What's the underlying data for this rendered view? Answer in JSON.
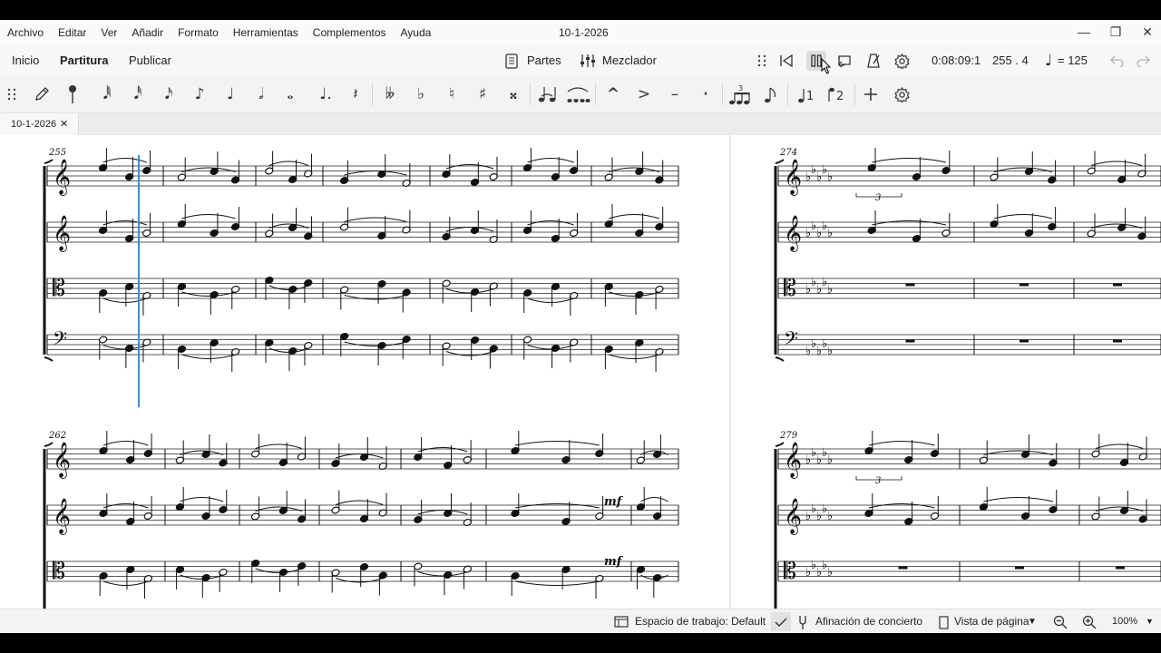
{
  "menu": [
    "Archivo",
    "Editar",
    "Ver",
    "Añadir",
    "Formato",
    "Herramientas",
    "Complementos",
    "Ayuda"
  ],
  "window": {
    "title": "10-1-2026",
    "minimize": "—",
    "restore": "❐",
    "close": "✕"
  },
  "tabs": {
    "home": "Inicio",
    "score": "Partitura",
    "publish": "Publicar"
  },
  "toolbar": {
    "parts_label": "Partes",
    "mixer_label": "Mezclador",
    "time": "0:08:09:1",
    "position": "255 . 4",
    "tempo_symbol": "♩",
    "tempo_value": "= 125"
  },
  "palette": {
    "dur_64": "𝅘𝅥𝅱",
    "dur_32": "𝅘𝅥𝅰",
    "dur_16": "𝅘𝅥𝅯",
    "dur_8": "♪",
    "dur_4": "♩",
    "dur_2": "𝅗𝅥",
    "dur_1": "𝅝",
    "dot": "♩.",
    "rest": "𝄽",
    "dbl_flat": "𝄫",
    "flat": "♭",
    "natural": "♮",
    "sharp": "♯",
    "dbl_sharp": "𝄪",
    "marcato": "^",
    "accent": ">",
    "tenuto": "–",
    "staccato": "·"
  },
  "doc_tab": {
    "name": "10-1-2026",
    "close": "✕"
  },
  "score": {
    "systems": [
      {
        "measure": "255"
      },
      {
        "measure": "274"
      },
      {
        "measure": "262"
      },
      {
        "measure": "279"
      }
    ],
    "dynamics": [
      "mf",
      "mf"
    ],
    "tuplet": "3"
  },
  "status": {
    "workspace": "Espacio de trabajo: Default",
    "concert_pitch": "Afinación de concierto",
    "view_mode": "Vista de página",
    "zoom": "100%"
  },
  "colors": {
    "cursor": "#3a8fd6",
    "accent": "#1a1a1a",
    "bg": "#f3f3f3"
  }
}
